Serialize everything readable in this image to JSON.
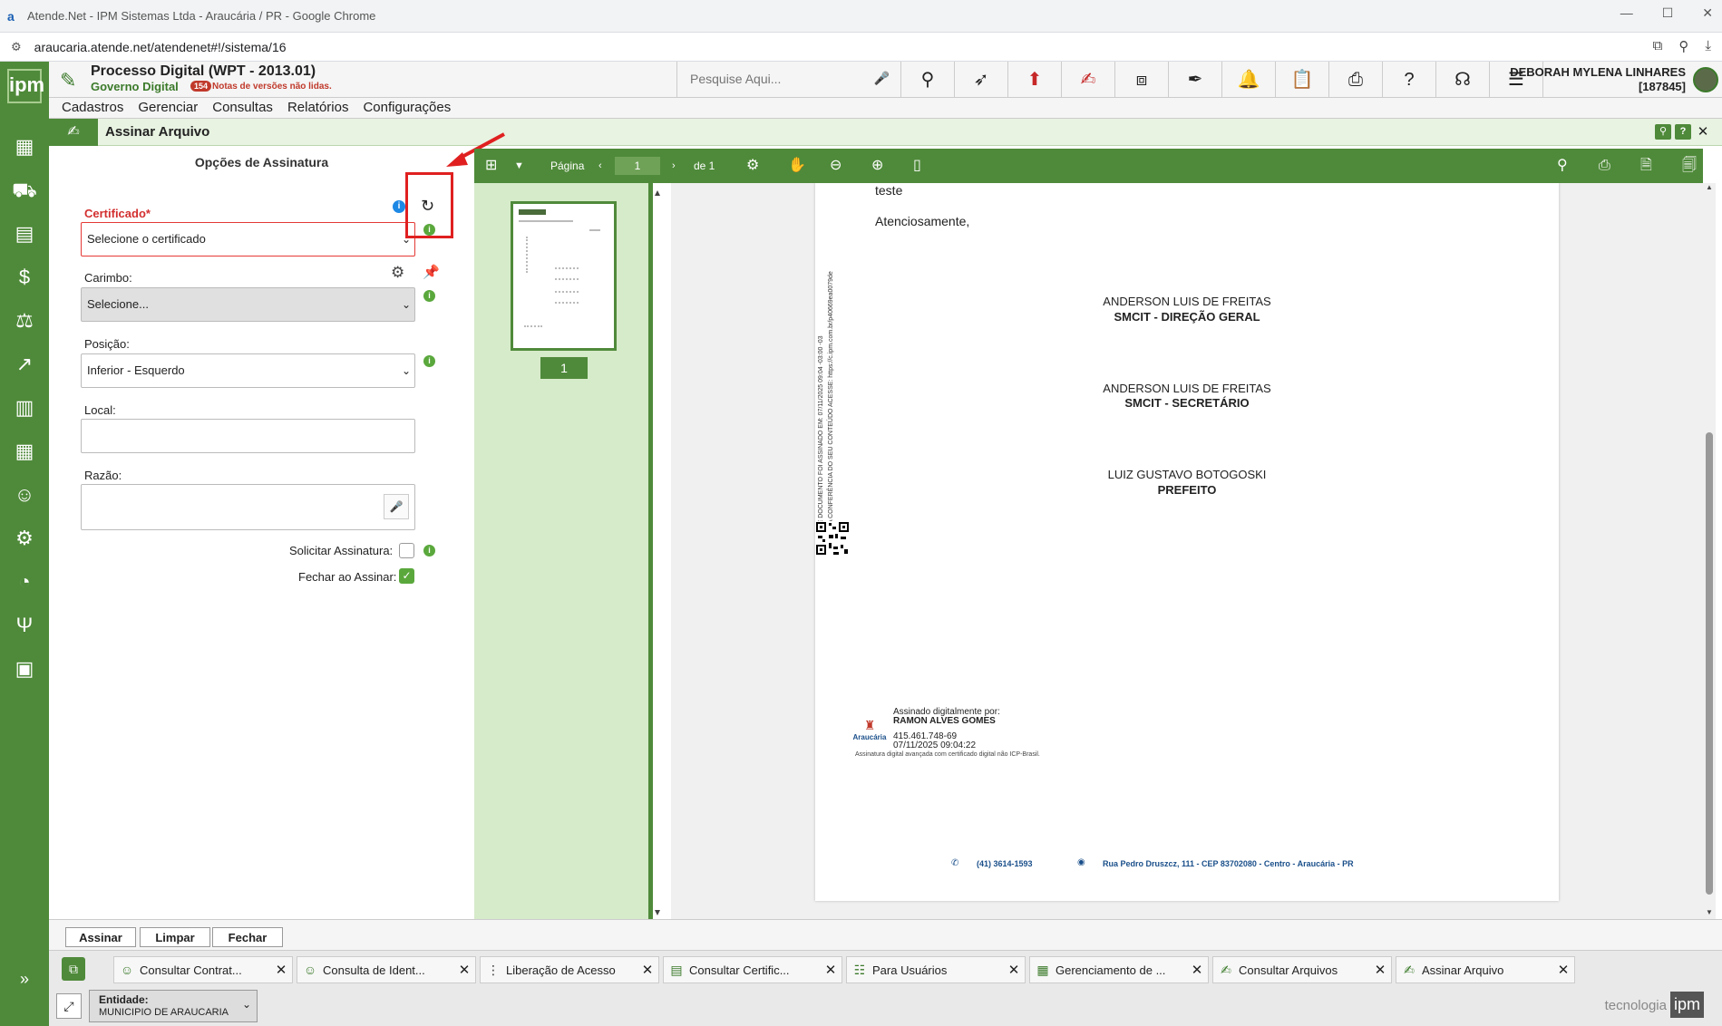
{
  "browser": {
    "title": "Atende.Net - IPM Sistemas Ltda - Araucária / PR - Google Chrome",
    "url": "araucaria.atende.net/atendenet#!/sistema/16",
    "min_glyph": "—",
    "max_glyph": "☐",
    "close_glyph": "✕"
  },
  "app": {
    "logo": "ipm",
    "system_title": "Processo Digital (WPT - 2013.01)",
    "system_subtitle": "Governo Digital",
    "notes_count": "154",
    "notes_text": "Notas de versões não lidas.",
    "search_placeholder": "Pesquise Aqui...",
    "user_name": "DEBORAH MYLENA LINHARES",
    "user_id": "[187845]"
  },
  "menu": [
    "Cadastros",
    "Gerenciar",
    "Consultas",
    "Relatórios",
    "Configurações"
  ],
  "window": {
    "title": "Assinar Arquivo"
  },
  "form": {
    "title": "Opções de Assinatura",
    "certificado_label": "Certificado*",
    "certificado_value": "Selecione o certificado",
    "carimbo_label": "Carimbo:",
    "carimbo_value": "Selecione...",
    "posicao_label": "Posição:",
    "posicao_value": "Inferior - Esquerdo",
    "local_label": "Local:",
    "local_value": "",
    "razao_label": "Razão:",
    "razao_value": "",
    "solicitar_label": "Solicitar Assinatura:",
    "solicitar_checked": false,
    "fechar_label": "Fechar ao Assinar:",
    "fechar_checked": true
  },
  "buttons": {
    "assinar": "Assinar",
    "limpar": "Limpar",
    "fechar": "Fechar"
  },
  "viewer": {
    "page_label": "Página",
    "current_page": "1",
    "total_pages": "de 1",
    "thumb_number": "1"
  },
  "document": {
    "text1": "teste",
    "text2": "Atenciosamente,",
    "signers": [
      {
        "name": "ANDERSON LUIS DE FREITAS",
        "role": "SMCIT - DIREÇÃO GERAL"
      },
      {
        "name": "ANDERSON LUIS DE FREITAS",
        "role": "SMCIT - SECRETÁRIO"
      },
      {
        "name": "LUIZ GUSTAVO BOTOGOSKI",
        "role": "PREFEITO"
      }
    ],
    "side_text": "ESTE DOCUMENTO FOI ASSINADO EM: 07/11/2025 09:04 -03:00 -03",
    "side_text2": "PARA CONFERÊNCIA DO SEU CONTEÚDO ACESSE: https://c.ipm.com.br/p40669ea0079de",
    "sig_header": "Assinado digitalmente por:",
    "sig_name": "RAMON ALVES GOMES",
    "sig_cpf": "415.461.748-69",
    "sig_date": "07/11/2025 09:04:22",
    "sig_note": "Assinatura digital avançada com certificado digital não ICP-Brasil.",
    "sig_logo_text": "Araucária",
    "footer_phone": "(41) 3614-1593",
    "footer_address": "Rua Pedro Druszcz, 111 - CEP 83702080 - Centro - Araucária - PR"
  },
  "tasks": [
    {
      "label": "Consultar Contrat...",
      "icon": "users-icon"
    },
    {
      "label": "Consulta de Ident...",
      "icon": "users-icon"
    },
    {
      "label": "Liberação de Acesso",
      "icon": "grip-icon"
    },
    {
      "label": "Consultar Certific...",
      "icon": "card-icon"
    },
    {
      "label": "Para Usuários",
      "icon": "list-icon"
    },
    {
      "label": "Gerenciamento de ...",
      "icon": "doc-icon"
    },
    {
      "label": "Consultar Arquivos",
      "icon": "sign-icon"
    },
    {
      "label": "Assinar Arquivo",
      "icon": "sign-icon"
    }
  ],
  "status": {
    "entidade_label": "Entidade:",
    "entidade_value": "MUNICIPIO DE ARAUCARIA",
    "brand": "tecnologia",
    "brand_logo": "ipm"
  },
  "colors": {
    "primary_green": "#4f8a3a",
    "annotation_red": "#e02020"
  }
}
